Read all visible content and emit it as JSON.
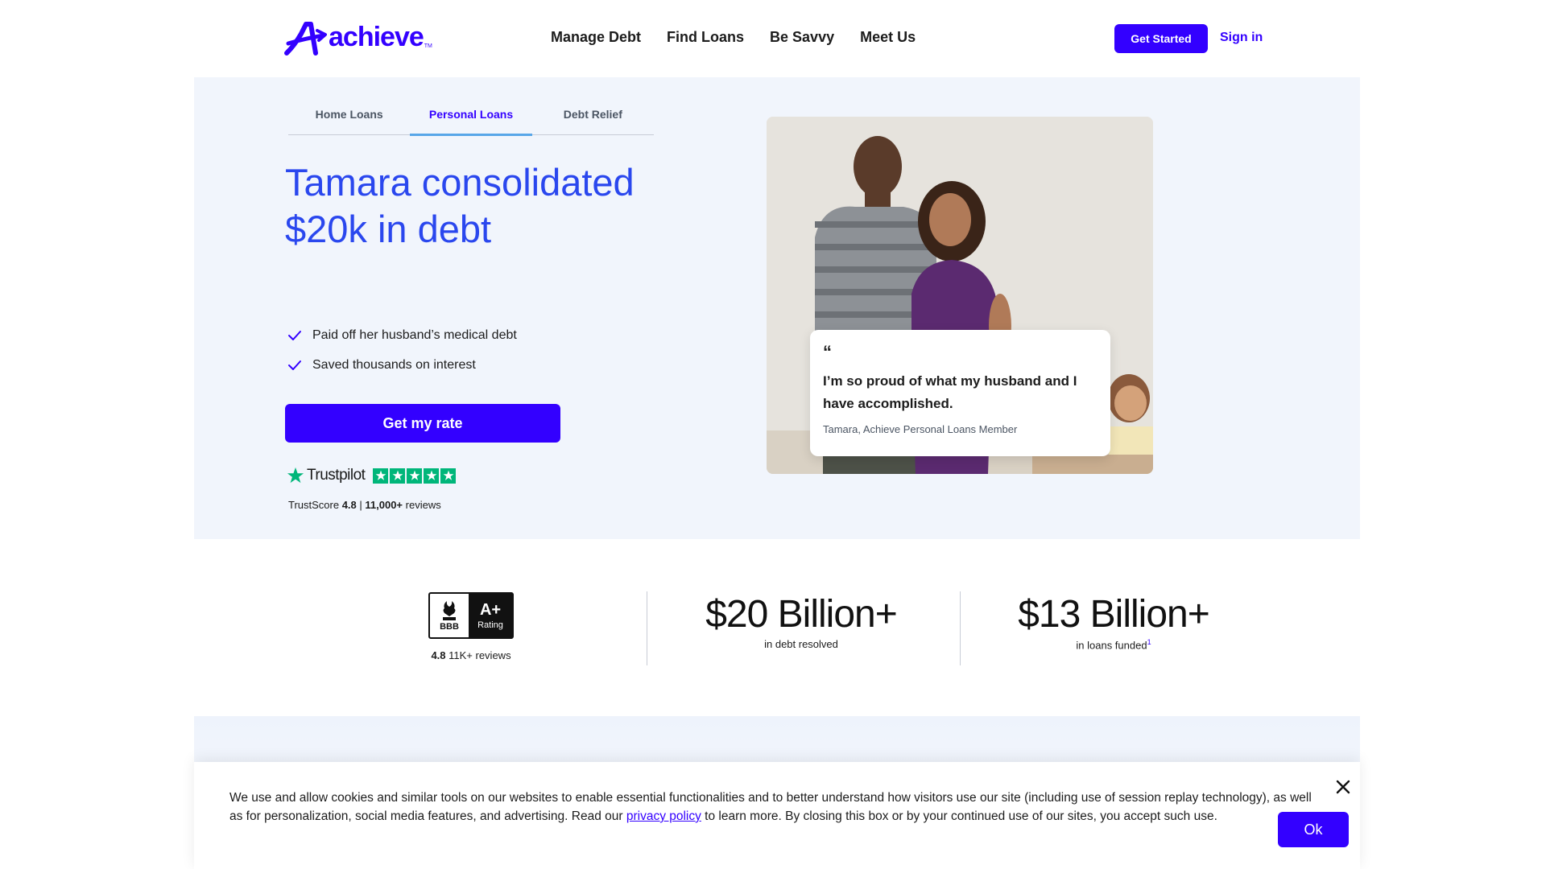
{
  "brand": {
    "name": "achieve",
    "tm": "TM",
    "color": "#3300ff"
  },
  "nav": {
    "items": [
      "Manage Debt",
      "Find Loans",
      "Be Savvy",
      "Meet Us"
    ],
    "get_started": "Get Started",
    "sign_in": "Sign in"
  },
  "hero": {
    "tabs": [
      {
        "label": "Home Loans",
        "active": false
      },
      {
        "label": "Personal Loans",
        "active": true
      },
      {
        "label": "Debt Relief",
        "active": false
      }
    ],
    "title": "Tamara consolidated $20k in debt",
    "bullets": [
      "Paid off her husband’s medical debt",
      "Saved thousands on interest"
    ],
    "cta": "Get my rate",
    "trustpilot": {
      "name": "Trustpilot",
      "stars": 5,
      "score_prefix": "TrustScore ",
      "score": "4.8",
      "separator": " | ",
      "reviews": "11,000+",
      "reviews_suffix": " reviews"
    },
    "quote": {
      "mark": "“",
      "text": "I’m so proud of what my husband and I have accomplished.",
      "author": "Tamara, Achieve Personal Loans Member"
    }
  },
  "stats": {
    "bbb": {
      "abbr": "BBB",
      "grade": "A+",
      "rating_label": "Rating",
      "score": "4.8",
      "reviews": " 11K+ reviews"
    },
    "debt_resolved": {
      "value": "$20 Billion+",
      "caption": "in debt resolved"
    },
    "loans_funded": {
      "value": "$13 Billion+",
      "caption": "in loans funded",
      "footnote": "1"
    }
  },
  "cookie": {
    "text_before": "We use and allow cookies and similar tools on our websites to enable essential functionalities and to better understand how visitors use our site (including use of session replay technology), as well as for personalization, social media features, and advertising. Read our ",
    "link": "privacy policy",
    "text_after": " to learn more. By closing this box or by your continued use of our sites, you accept such use.",
    "ok": "Ok"
  }
}
